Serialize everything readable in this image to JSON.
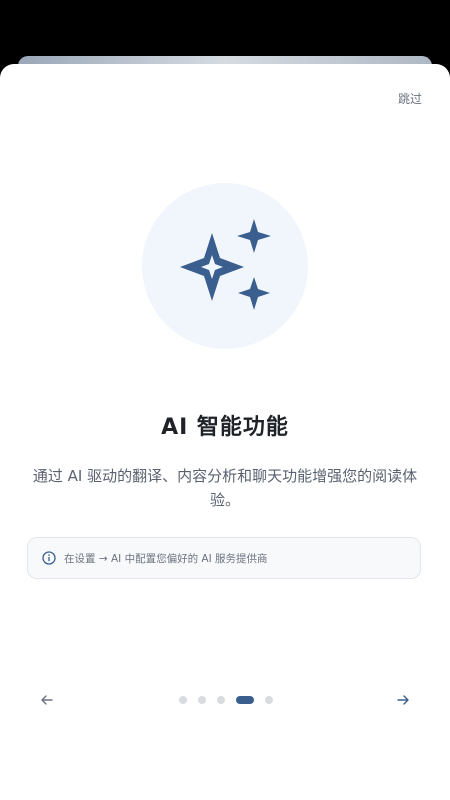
{
  "header": {
    "skip_label": "跳过"
  },
  "hero": {
    "icon": "sparkles-icon"
  },
  "content": {
    "title": "AI 智能功能",
    "description": "通过 AI 驱动的翻译、内容分析和聊天功能增强您的阅读体验。"
  },
  "info": {
    "icon": "info-icon",
    "text": "在设置 → AI 中配置您偏好的 AI 服务提供商"
  },
  "pagination": {
    "total": 5,
    "active_index": 3
  },
  "nav": {
    "prev_icon": "arrow-left-icon",
    "next_icon": "arrow-right-icon"
  },
  "colors": {
    "accent": "#3a5f8f",
    "hero_bg": "#f1f6fd",
    "dot_inactive": "#d8dbe0"
  }
}
